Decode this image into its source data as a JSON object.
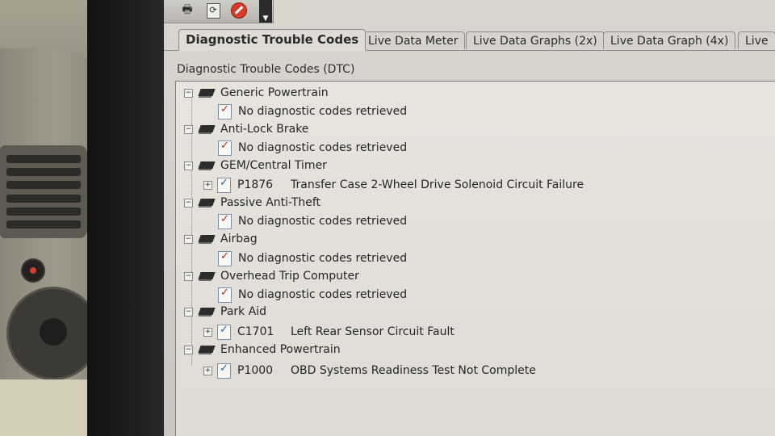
{
  "toolbar": {
    "icons": [
      "print-icon",
      "refresh-icon",
      "stop-icon"
    ]
  },
  "tabs": [
    {
      "label": "Diagnostic Trouble Codes",
      "active": true
    },
    {
      "label": "Live Data Meter",
      "active": false
    },
    {
      "label": "Live Data Graphs (2x)",
      "active": false
    },
    {
      "label": "Live Data Graph (4x)",
      "active": false
    },
    {
      "label": "Live",
      "active": false
    }
  ],
  "dtc_panel": {
    "title": "Diagnostic Trouble Codes (DTC)",
    "modules": [
      {
        "name": "Generic Powertrain",
        "entries": [
          {
            "code": "",
            "description": "No diagnostic codes retrieved"
          }
        ]
      },
      {
        "name": "Anti-Lock Brake",
        "entries": [
          {
            "code": "",
            "description": "No diagnostic codes retrieved"
          }
        ]
      },
      {
        "name": "GEM/Central Timer",
        "entries": [
          {
            "code": "P1876",
            "description": "Transfer Case 2-Wheel Drive Solenoid Circuit Failure"
          }
        ]
      },
      {
        "name": "Passive Anti-Theft",
        "entries": [
          {
            "code": "",
            "description": "No diagnostic codes retrieved"
          }
        ]
      },
      {
        "name": "Airbag",
        "entries": [
          {
            "code": "",
            "description": "No diagnostic codes retrieved"
          }
        ]
      },
      {
        "name": "Overhead Trip Computer",
        "entries": [
          {
            "code": "",
            "description": "No diagnostic codes retrieved"
          }
        ]
      },
      {
        "name": "Park Aid",
        "entries": [
          {
            "code": "C1701",
            "description": "Left Rear Sensor Circuit Fault"
          }
        ]
      },
      {
        "name": "Enhanced Powertrain",
        "entries": [
          {
            "code": "P1000",
            "description": "OBD Systems Readiness Test Not Complete"
          }
        ]
      }
    ]
  },
  "expander_symbols": {
    "expanded": "−",
    "collapsed": "+"
  }
}
